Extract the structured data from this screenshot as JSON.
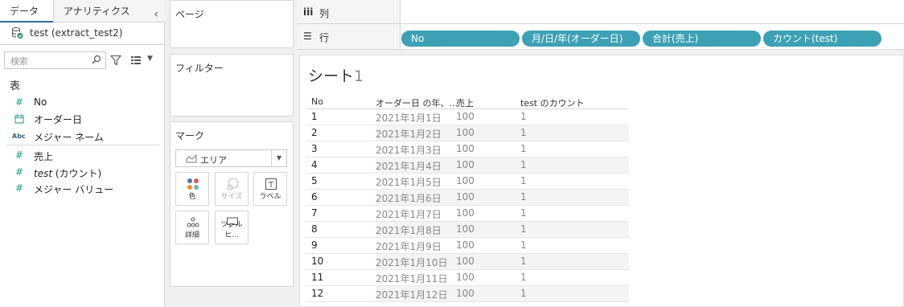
{
  "left_pane": {
    "tabs": [
      "データ",
      "アナリティクス"
    ],
    "collapse_icon": "chevron-left-icon",
    "datasource": "test (extract_test2)",
    "search_placeholder": "検索",
    "section_title": "表",
    "fields": [
      {
        "icon": "#",
        "label": "No"
      },
      {
        "icon": "calendar",
        "label": "オーダー日"
      },
      {
        "icon": "Abc",
        "label": "メジャー ネーム"
      },
      {
        "icon": "#",
        "label": "売上"
      },
      {
        "icon": "#",
        "label_italic": "test",
        "label_rest": " (カウント)"
      },
      {
        "icon": "#",
        "label": "メジャー バリュー"
      }
    ]
  },
  "cards": {
    "pages": "ページ",
    "filters": "フィルター",
    "marks": "マーク",
    "mark_type": "エリア",
    "mark_buttons": [
      {
        "label": "色"
      },
      {
        "label": "サイズ"
      },
      {
        "label": "ラベル"
      },
      {
        "label": "詳細"
      },
      {
        "label": "ツールヒ..."
      }
    ]
  },
  "shelves": {
    "columns_icon": "iii",
    "columns_label": "列",
    "rows_icon": "☰",
    "rows_label": "行",
    "row_pills": [
      "No",
      "月/日/年(オーダー日)",
      "合計(売上)",
      "カウント(test)"
    ]
  },
  "sheet": {
    "title": "シート",
    "title_num": "1",
    "headers": [
      "No",
      "オーダー日 の年、...",
      "売上",
      "test のカウント"
    ],
    "rows": [
      [
        "1",
        "2021年1月1日",
        "100",
        "1"
      ],
      [
        "2",
        "2021年1月2日",
        "100",
        "1"
      ],
      [
        "3",
        "2021年1月3日",
        "100",
        "1"
      ],
      [
        "4",
        "2021年1月4日",
        "100",
        "1"
      ],
      [
        "5",
        "2021年1月5日",
        "100",
        "1"
      ],
      [
        "6",
        "2021年1月6日",
        "100",
        "1"
      ],
      [
        "7",
        "2021年1月7日",
        "100",
        "1"
      ],
      [
        "8",
        "2021年1月8日",
        "100",
        "1"
      ],
      [
        "9",
        "2021年1月9日",
        "100",
        "1"
      ],
      [
        "10",
        "2021年1月10日",
        "100",
        "1"
      ],
      [
        "11",
        "2021年1月11日",
        "100",
        "1"
      ],
      [
        "12",
        "2021年1月12日",
        "100",
        "1"
      ]
    ]
  },
  "colors": {
    "pill": "#3da1b6",
    "field_icon": "#1e9a8c",
    "tab_underline": "#2f6f97"
  }
}
